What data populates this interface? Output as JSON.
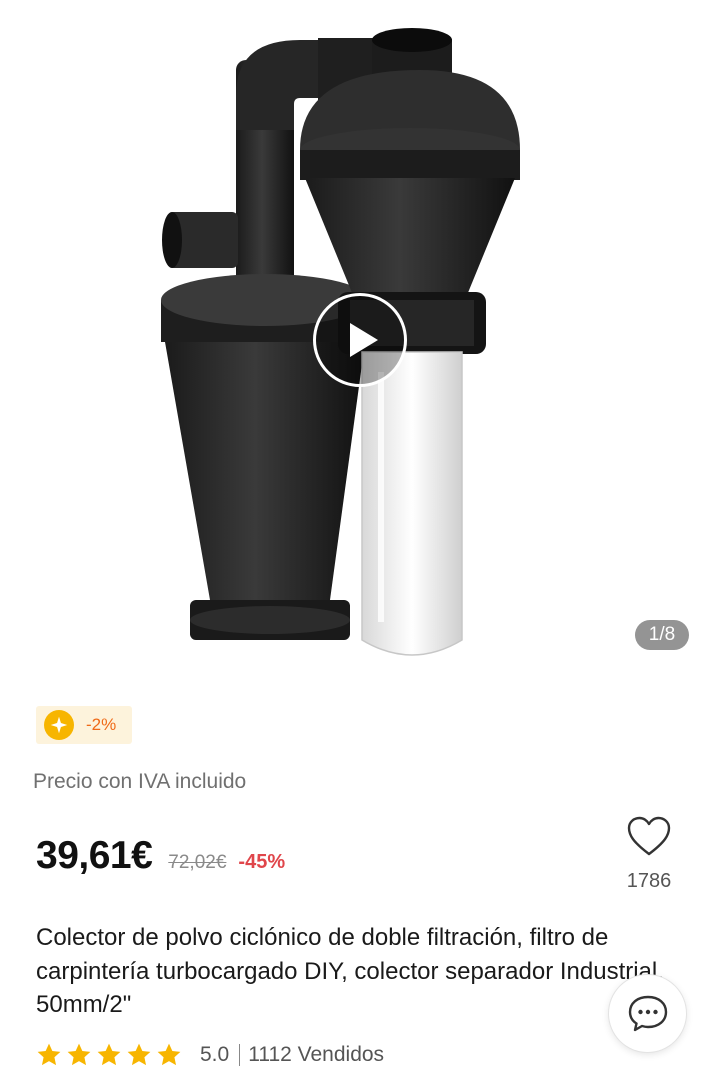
{
  "gallery": {
    "image_alt": "Colector de polvo ciclónico",
    "counter": "1/8",
    "play_icon": "play-icon"
  },
  "coin_badge": {
    "icon": "coin-star-icon",
    "text": "-2%"
  },
  "pricing": {
    "vat_note": "Precio con IVA incluido",
    "current": "39,61€",
    "original": "72,02€",
    "discount": "-45%"
  },
  "wishlist": {
    "icon": "heart-icon",
    "count": "1786"
  },
  "product": {
    "title": "Colector de polvo ciclónico de doble filtración, filtro de carpintería turbocargado DIY, colector separador Industrial, 50mm/2\""
  },
  "rating": {
    "stars": 5,
    "value": "5.0",
    "sold": "1112 Vendidos"
  },
  "chat": {
    "icon": "chat-bubble-icon"
  },
  "colors": {
    "price_discount": "#e0464b",
    "coin_badge_bg": "#fdf3dc",
    "coin": "#f7b500",
    "star": "#f7b500"
  }
}
